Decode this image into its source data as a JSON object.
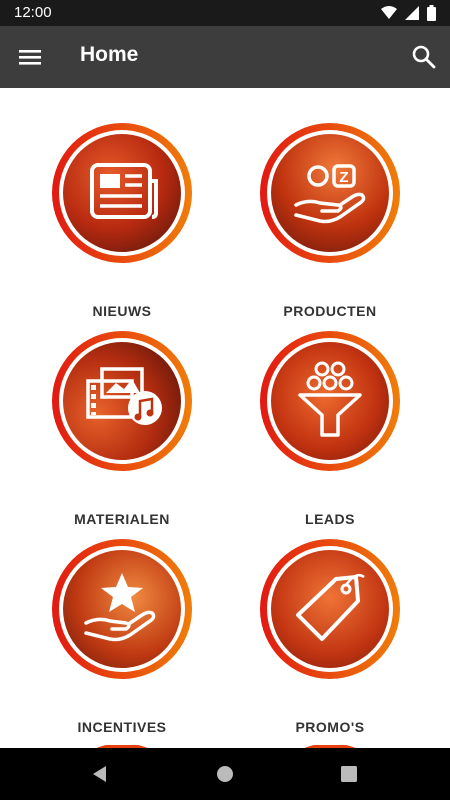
{
  "status_bar": {
    "time": "12:00"
  },
  "app_bar": {
    "title": "Home"
  },
  "tiles": [
    {
      "label": "NIEUWS",
      "icon": "newspaper-icon"
    },
    {
      "label": "PRODUCTEN",
      "icon": "hand-products-icon"
    },
    {
      "label": "MATERIALEN",
      "icon": "media-icon"
    },
    {
      "label": "LEADS",
      "icon": "funnel-icon"
    },
    {
      "label": "INCENTIVES",
      "icon": "hand-star-icon"
    },
    {
      "label": "PROMO'S",
      "icon": "tag-icon"
    }
  ],
  "colors": {
    "accent_red": "#e11a12",
    "accent_orange": "#f07d0a",
    "appbar": "#3d3d3d"
  }
}
